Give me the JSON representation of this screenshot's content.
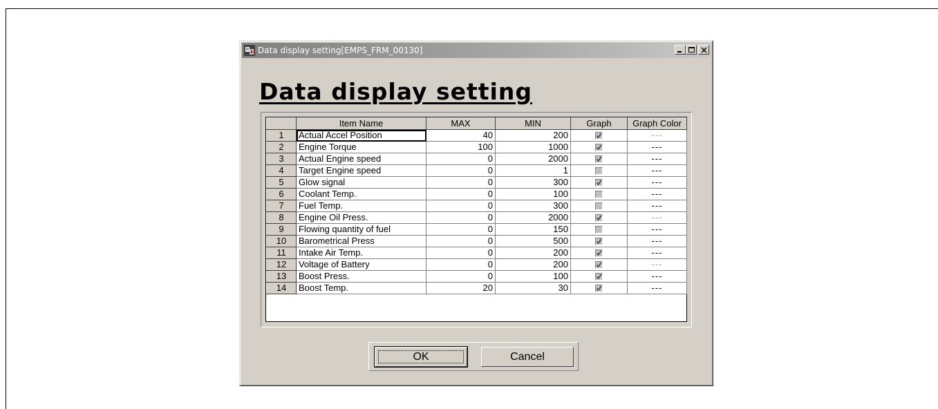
{
  "window": {
    "title": "Data display setting[EMPS_FRM_00130]",
    "heading": "Data display setting"
  },
  "grid": {
    "columns": [
      "",
      "Item Name",
      "MAX",
      "MIN",
      "Graph",
      "Graph Color"
    ],
    "rows": [
      {
        "num": "1",
        "name": "Actual Accel Position",
        "max": "40",
        "min": "200",
        "graph": true,
        "color": "---",
        "color_faint": true
      },
      {
        "num": "2",
        "name": "Engine Torque",
        "max": "100",
        "min": "1000",
        "graph": true,
        "color": "---",
        "color_faint": false
      },
      {
        "num": "3",
        "name": "Actual Engine speed",
        "max": "0",
        "min": "2000",
        "graph": true,
        "color": "---",
        "color_faint": false
      },
      {
        "num": "4",
        "name": "Target Engine speed",
        "max": "0",
        "min": "1",
        "graph": false,
        "color": "---",
        "color_faint": false
      },
      {
        "num": "5",
        "name": "Glow signal",
        "max": "0",
        "min": "300",
        "graph": true,
        "color": "---",
        "color_faint": false
      },
      {
        "num": "6",
        "name": "Coolant Temp.",
        "max": "0",
        "min": "100",
        "graph": false,
        "color": "---",
        "color_faint": false
      },
      {
        "num": "7",
        "name": "Fuel Temp.",
        "max": "0",
        "min": "300",
        "graph": false,
        "color": "---",
        "color_faint": false
      },
      {
        "num": "8",
        "name": "Engine Oil Press.",
        "max": "0",
        "min": "2000",
        "graph": true,
        "color": "---",
        "color_faint": true
      },
      {
        "num": "9",
        "name": "Flowing quantity of fuel",
        "max": "0",
        "min": "150",
        "graph": false,
        "color": "---",
        "color_faint": false
      },
      {
        "num": "10",
        "name": "Barometrical Press",
        "max": "0",
        "min": "500",
        "graph": true,
        "color": "---",
        "color_faint": false
      },
      {
        "num": "11",
        "name": "Intake Air Temp.",
        "max": "0",
        "min": "200",
        "graph": true,
        "color": "---",
        "color_faint": false
      },
      {
        "num": "12",
        "name": "Voltage of Battery",
        "max": "0",
        "min": "200",
        "graph": true,
        "color": "---",
        "color_faint": true
      },
      {
        "num": "13",
        "name": "Boost Press.",
        "max": "0",
        "min": "100",
        "graph": true,
        "color": "---",
        "color_faint": false
      },
      {
        "num": "14",
        "name": "Boost Temp.",
        "max": "20",
        "min": "30",
        "graph": true,
        "color": "---",
        "color_faint": false
      }
    ]
  },
  "buttons": {
    "ok": "OK",
    "cancel": "Cancel"
  }
}
